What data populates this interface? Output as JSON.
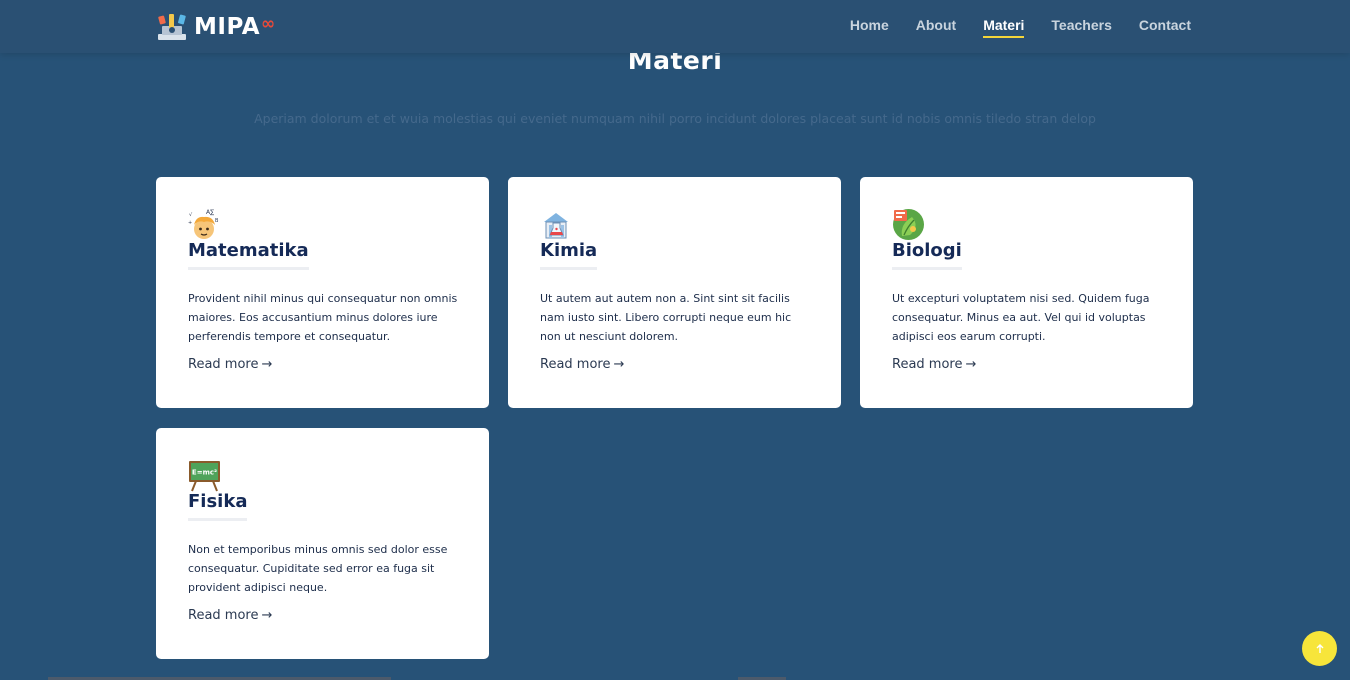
{
  "brand": {
    "name": "MIPA",
    "suffix": "∞",
    "logo_icon": "science-logo-icon"
  },
  "nav": {
    "items": [
      {
        "label": "Home",
        "active": false
      },
      {
        "label": "About",
        "active": false
      },
      {
        "label": "Materi",
        "active": true
      },
      {
        "label": "Teachers",
        "active": false
      },
      {
        "label": "Contact",
        "active": false
      }
    ]
  },
  "section": {
    "title": "Materi",
    "subtitle": "Aperiam dolorum et et wuia molestias qui eveniet numquam nihil porro incidunt dolores placeat sunt id nobis omnis tiledo stran delop"
  },
  "cards": [
    {
      "icon": "math-student-icon",
      "title": "Matematika",
      "text": "Provident nihil minus qui consequatur non omnis maiores. Eos accusantium minus dolores iure perferendis tempore et consequatur.",
      "link": "Read more"
    },
    {
      "icon": "chemistry-lab-icon",
      "title": "Kimia",
      "text": "Ut autem aut autem non a. Sint sint sit facilis nam iusto sint. Libero corrupti neque eum hic non ut nesciunt dolorem.",
      "link": "Read more"
    },
    {
      "icon": "biology-leaf-icon",
      "title": "Biologi",
      "text": "Ut excepturi voluptatem nisi sed. Quidem fuga consequatur. Minus ea aut. Vel qui id voluptas adipisci eos earum corrupti.",
      "link": "Read more"
    },
    {
      "icon": "physics-board-icon",
      "title": "Fisika",
      "text": "Non et temporibus minus omnis sed dolor esse consequatur. Cupiditate sed error ea fuga sit provident adipisci neque.",
      "link": "Read more",
      "board_text": "E=mc²"
    }
  ],
  "colors": {
    "background": "#275277",
    "header": "#2a5073",
    "accent": "#f3d53a",
    "card_title": "#152a57"
  },
  "back_to_top": {
    "icon": "arrow-up-icon"
  }
}
